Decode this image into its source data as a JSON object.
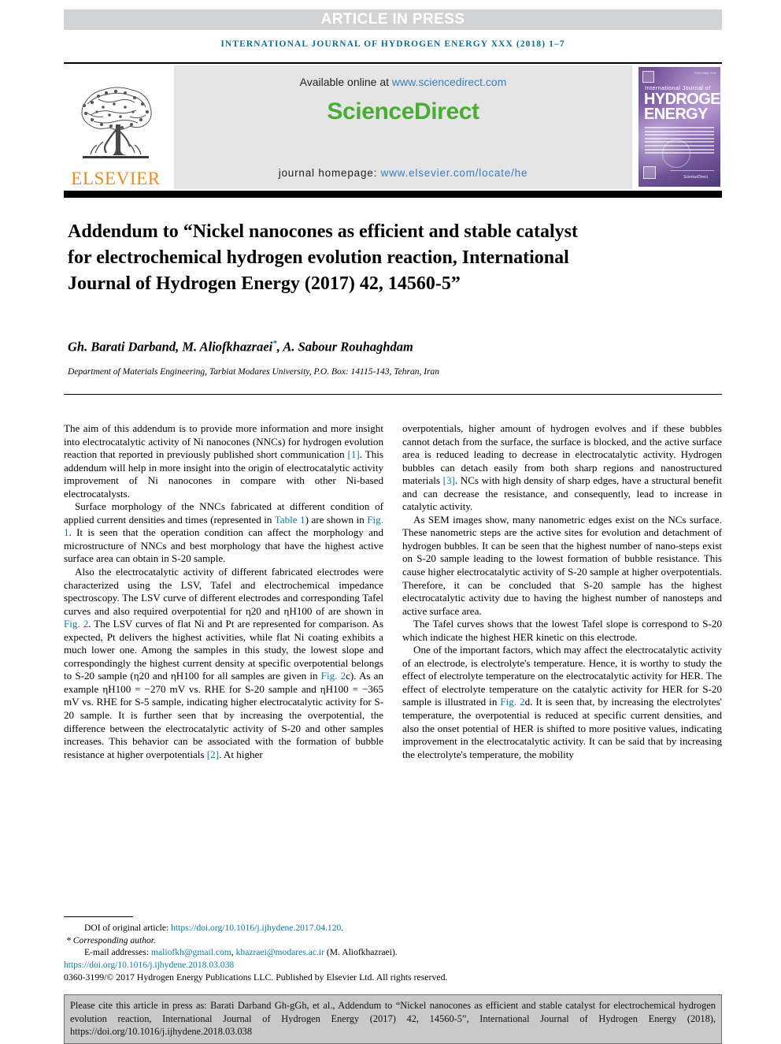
{
  "banner": {
    "text": "ARTICLE IN PRESS"
  },
  "running_head": {
    "text": "INTERNATIONAL JOURNAL OF HYDROGEN ENERGY XXX (2018) 1–7"
  },
  "masthead": {
    "publisher_name": "ELSEVIER",
    "available_label": "Available online at ",
    "available_url": "www.sciencedirect.com",
    "sciencedirect_logo": "ScienceDirect",
    "homepage_label": "journal homepage: ",
    "homepage_url": "www.elsevier.com/locate/he",
    "cover": {
      "issn": "ISSN 0360-3199",
      "line1": "International Journal of",
      "line2": "HYDROGEN",
      "line3": "ENERGY",
      "imprint": "ScienceDirect"
    }
  },
  "article": {
    "title": "Addendum to “Nickel nanocones as efficient and stable catalyst for electrochemical hydrogen evolution reaction, International Journal of Hydrogen Energy (2017) 42, 14560-5”",
    "authors_pre": "Gh. Barati Darband, M. Aliofkhazraei",
    "authors_marker": "*",
    "authors_post": ", A. Sabour Rouhaghdam",
    "affiliation": "Department of Materials Engineering, Tarbiat Modares University, P.O. Box: 14115-143, Tehran, Iran"
  },
  "body": {
    "left": {
      "p1_a": "The aim of this addendum is to provide more information and more insight into electrocatalytic activity of Ni nanocones (NNCs) for hydrogen evolution reaction that reported in previously published short communication ",
      "p1_ref1": "[1]",
      "p1_b": ". This addendum will help in more insight into the origin of electrocatalytic activity improvement of Ni nanocones in compare with other Ni-based electrocatalysts.",
      "p2_a": "Surface morphology of the NNCs fabricated at different condition of applied current densities and times (represented in ",
      "p2_ref_table": "Table 1",
      "p2_b": ") are shown in ",
      "p2_ref_fig": "Fig. 1",
      "p2_c": ". It is seen that the operation condition can affect the morphology and microstructure of NNCs and best morphology that have the highest active surface area can obtain in S-20 sample.",
      "p3_a": "Also the electrocatalytic activity of different fabricated electrodes were characterized using the LSV, Tafel and electrochemical impedance spectroscopy. The LSV curve of different electrodes and corresponding Tafel curves and also required overpotential for ",
      "p3_eta20": "η20",
      "p3_b": " and ",
      "p3_eta100": "ηH100",
      "p3_c": " of are shown in ",
      "p3_ref_fig2": "Fig. 2",
      "p3_d": ". The LSV curves of flat Ni and Pt are represented for comparison. As expected, Pt delivers the highest activities, while flat Ni coating exhibits a much lower one. Among the samples in this study, the lowest slope and correspondingly the highest current density at specific overpotential belongs to S-20 sample (",
      "p3_eta20b": "η20",
      "p3_e": " and ",
      "p3_eta100b": "ηH100",
      "p3_f": " for all samples are given in ",
      "p3_ref_fig2c": "Fig. 2",
      "p3_g": "c). As an example ",
      "p3_eta100c": "ηH100",
      "p3_h": " = −270 mV vs. RHE for S-20 sample and ",
      "p3_eta100d": "ηH100",
      "p3_i": " = −365 mV vs. RHE for S-5 sample, indicating higher electrocatalytic activity for S-20 sample. It is further seen that by increasing the overpotential, the difference between the electrocatalytic activity of S-20 and other samples increases. This behavior can be associated with the formation of bubble resistance at higher overpotentials ",
      "p3_ref2": "[2]",
      "p3_j": ". At higher"
    },
    "right": {
      "p1_a": "overpotentials, higher amount of hydrogen evolves and if these bubbles cannot detach from the surface, the surface is blocked, and the active surface area is reduced leading to decrease in electrocatalytic activity. Hydrogen bubbles can detach easily from both sharp regions and nanostructured materials ",
      "p1_ref3": "[3]",
      "p1_b": ". NCs with high density of sharp edges, have a structural benefit and can decrease the resistance, and consequently, lead to increase in catalytic activity.",
      "p2": "As SEM images show, many nanometric edges exist on the NCs surface. These nanometric steps are the active sites for evolution and detachment of hydrogen bubbles. It can be seen that the highest number of nano-steps exist on S-20 sample leading to the lowest formation of bubble resistance. This cause higher electrocatalytic activity of S-20 sample at higher overpotentials. Therefore, it can be concluded that S-20 sample has the highest electrocatalytic activity due to having the highest number of nanosteps and active surface area.",
      "p3": "The Tafel curves shows that the lowest Tafel slope is correspond to S-20 which indicate the highest HER kinetic on this electrode.",
      "p4_a": "One of the important factors, which may affect the electrocatalytic activity of an electrode, is electrolyte's temperature. Hence, it is worthy to study the effect of electrolyte temperature on the electrocatalytic activity for HER. The effect of electrolyte temperature on the catalytic activity for HER for S-20 sample is illustrated in ",
      "p4_ref_fig2d": "Fig. 2",
      "p4_b": "d. It is seen that, by increasing the electrolytes' temperature, the overpotential is reduced at specific current densities, and also the onset potential of HER is shifted to more positive values, indicating improvement in the electrocatalytic activity. It can be said that by increasing the electrolyte's temperature, the mobility"
    }
  },
  "footnotes": {
    "doi_label": "DOI of original article: ",
    "doi_url": "https://doi.org/10.1016/j.ijhydene.2017.04.120",
    "doi_period": ".",
    "corresponding": "Corresponding author.",
    "email_label": "E-mail addresses: ",
    "email1": "maliofkh@gmail.com",
    "email_sep": ", ",
    "email2": "khazraei@modares.ac.ir",
    "email_suffix": " (M. Aliofkhazraei).",
    "article_doi": "https://doi.org/10.1016/j.ijhydene.2018.03.038",
    "copyright": "0360-3199/© 2017 Hydrogen Energy Publications LLC. Published by Elsevier Ltd. All rights reserved."
  },
  "cite_box": {
    "text": "Please cite this article in press as: Barati Darband Gh-gGh, et al., Addendum to “Nickel nanocones as efficient and stable catalyst for electrochemical hydrogen evolution reaction, International Journal of Hydrogen Energy (2017) 42, 14560-5”, International Journal of Hydrogen Energy (2018), https://doi.org/10.1016/j.ijhydene.2018.03.038"
  },
  "colors": {
    "link": "#0b7ca8",
    "running_head": "#0b6e92",
    "elsevier_orange": "#f08a1c",
    "sciencedirect_green": "#4aad33",
    "banner_grey": "#d2d3d5",
    "sd_box_grey": "#e5e5e5",
    "cite_box_grey": "#c9c9c9"
  }
}
